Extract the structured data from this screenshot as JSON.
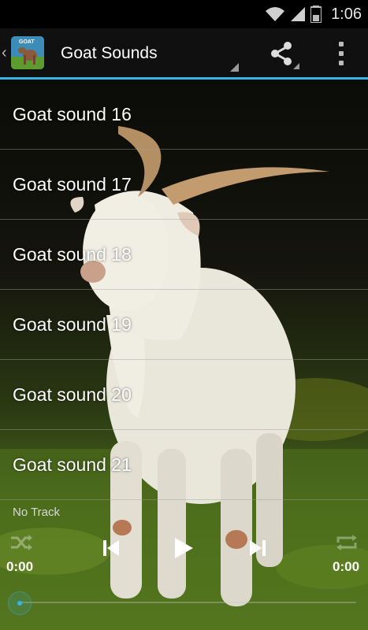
{
  "status_bar": {
    "time": "1:06"
  },
  "action_bar": {
    "title": "Goat Sounds",
    "app_icon_label": "GOAT",
    "icons": [
      "back-caret-icon",
      "share-icon",
      "overflow-menu-icon"
    ]
  },
  "sounds": [
    "Goat sound 16",
    "Goat sound 17",
    "Goat sound 18",
    "Goat sound 19",
    "Goat sound 20",
    "Goat sound 21"
  ],
  "player": {
    "track": "No Track",
    "elapsed": "0:00",
    "duration": "0:00",
    "progress": 0
  },
  "colors": {
    "accent": "#33b5e5",
    "action_bar": "#101010"
  }
}
